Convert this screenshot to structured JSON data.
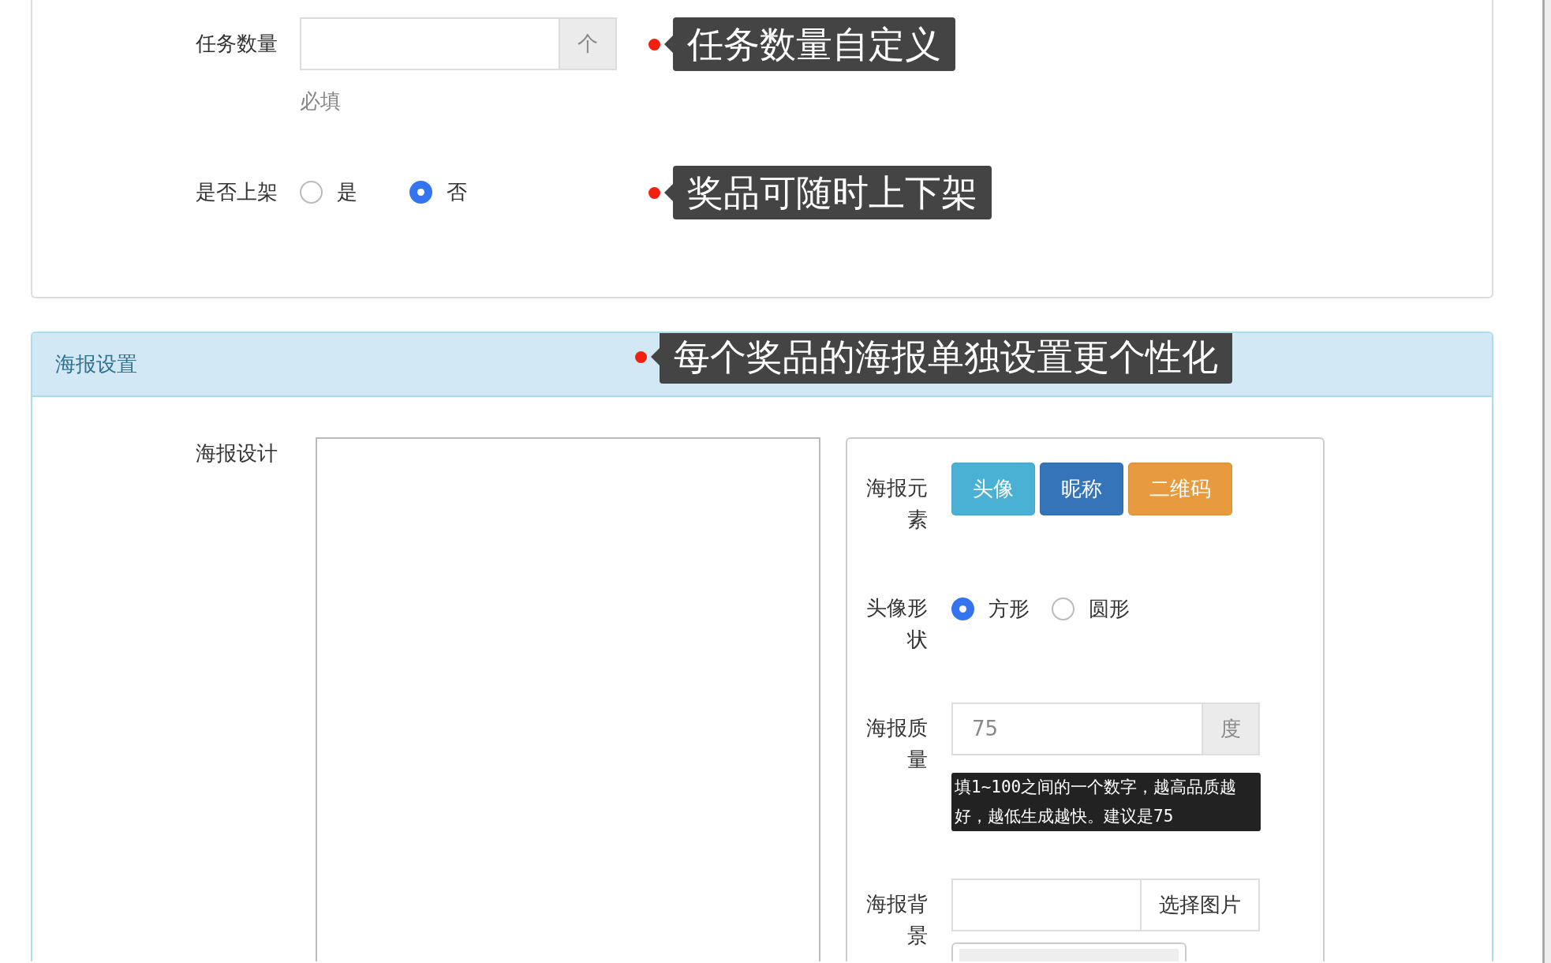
{
  "task_settings": {
    "rows": [
      {
        "kind": "number",
        "label": "任务数量",
        "addon": "个",
        "help": "必填",
        "callout": "任务数量自定义"
      },
      {
        "kind": "radio",
        "label": "是否上架",
        "options": [
          {
            "label": "是",
            "selected": false
          },
          {
            "label": "否",
            "selected": true
          }
        ],
        "callout": "奖品可随时上下架"
      }
    ]
  },
  "poster_panel": {
    "title": "海报设置",
    "callout": "每个奖品的海报单独设置更个性化",
    "design_label": "海报设计",
    "settings": [
      {
        "kind": "buttons",
        "label": "海报元素",
        "buttons": [
          {
            "label": "头像",
            "color": "#4bb1d4"
          },
          {
            "label": "昵称",
            "color": "#3574b8"
          },
          {
            "label": "二维码",
            "color": "#e89b3e"
          }
        ]
      },
      {
        "kind": "radio",
        "label": "头像形状",
        "options": [
          {
            "label": "方形",
            "selected": true
          },
          {
            "label": "圆形",
            "selected": false
          }
        ]
      },
      {
        "kind": "number",
        "label": "海报质量",
        "placeholder": "75",
        "addon": "度",
        "help": "填1~100之间的一个数字，越高品质越好，越低生成越快。建议是75"
      },
      {
        "kind": "file",
        "label": "海报背景",
        "button": "选择图片"
      }
    ]
  }
}
